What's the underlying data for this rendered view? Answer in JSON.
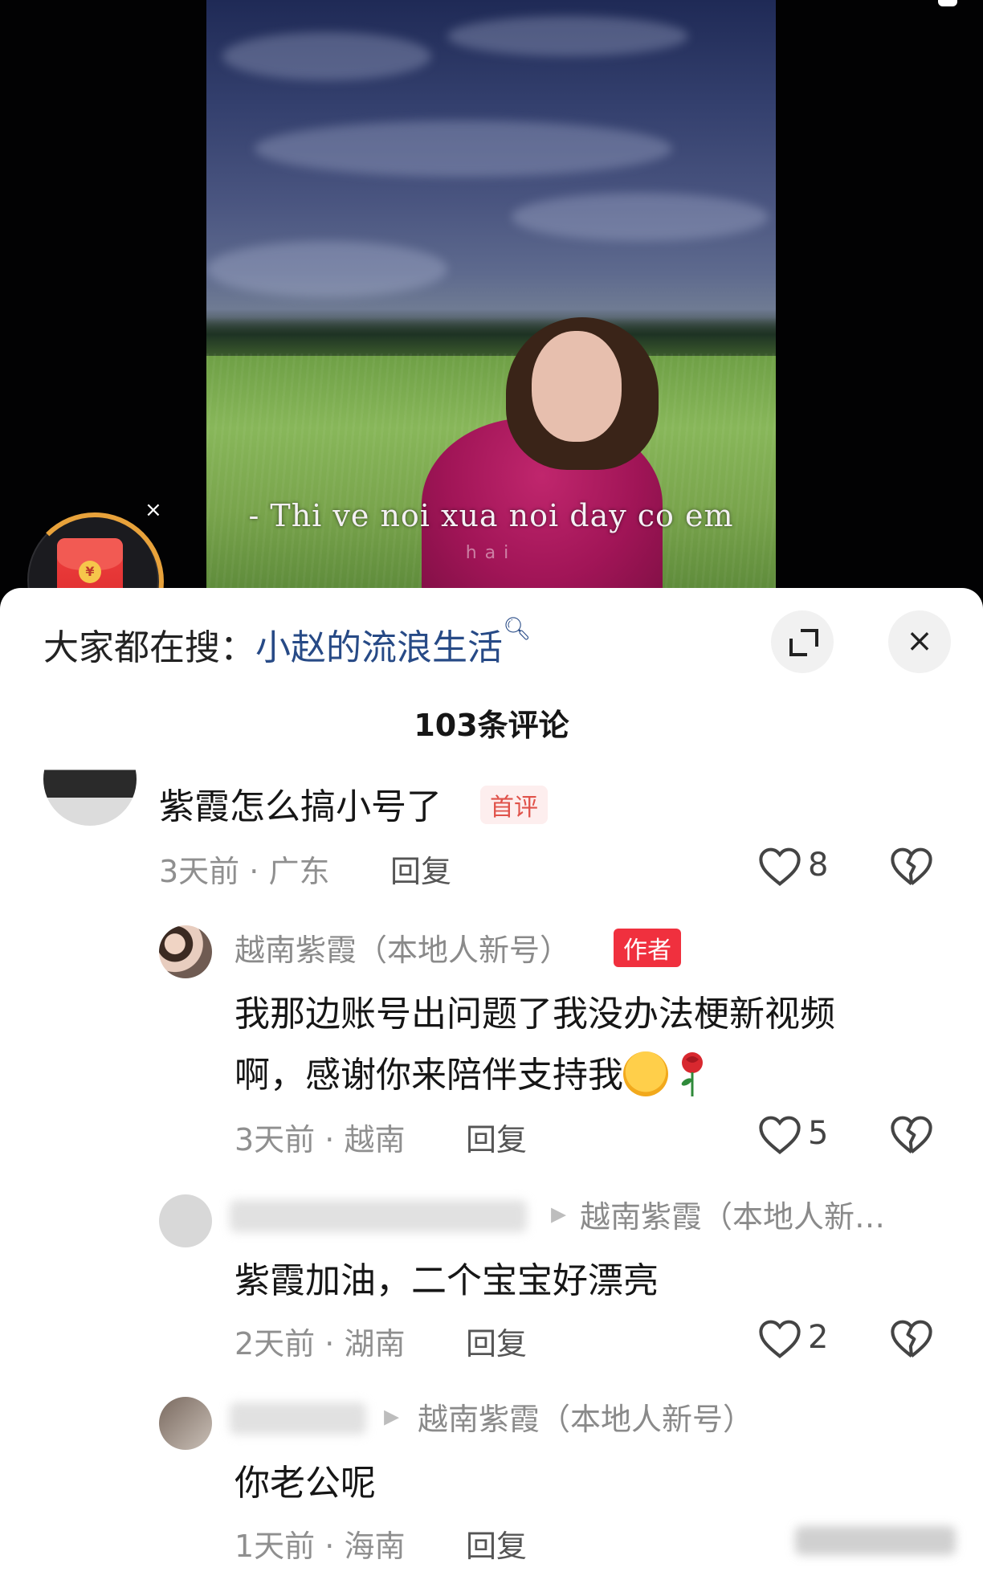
{
  "video": {
    "subtitle": "- Thi ve noi xua noi day co em",
    "subtitle_sub": "hai",
    "redpacket_symbol": "¥",
    "close_symbol": "×"
  },
  "sheet": {
    "search_prefix": "大家都在搜：",
    "search_keyword": "小赵的流浪生活",
    "search_icon": "search-icon",
    "comment_count": "103条评论",
    "close_symbol": "×"
  },
  "comments": [
    {
      "text": "紫霞怎么搞小号了",
      "badge": "首评",
      "time": "3天前",
      "location": "广东",
      "reply_label": "回复",
      "likes": "8"
    },
    {
      "username": "越南紫霞（本地人新号）",
      "badge": "作者",
      "text_line1": "我那边账号出问题了我没办法梗新视频",
      "text_line2": "啊，感谢你来陪伴支持我",
      "time": "3天前",
      "location": "越南",
      "reply_label": "回复",
      "likes": "5"
    },
    {
      "reply_to": "越南紫霞（本地人新…",
      "text": "紫霞加油，二个宝宝好漂亮",
      "time": "2天前",
      "location": "湖南",
      "reply_label": "回复",
      "likes": "2"
    },
    {
      "reply_to": "越南紫霞（本地人新号）",
      "text": "你老公呢",
      "time": "1天前",
      "location": "海南",
      "reply_label": "回复"
    }
  ],
  "separator": "·",
  "colors": {
    "keyword": "#274a86",
    "author_badge": "#f0303e",
    "first_badge_text": "#e0524a"
  }
}
